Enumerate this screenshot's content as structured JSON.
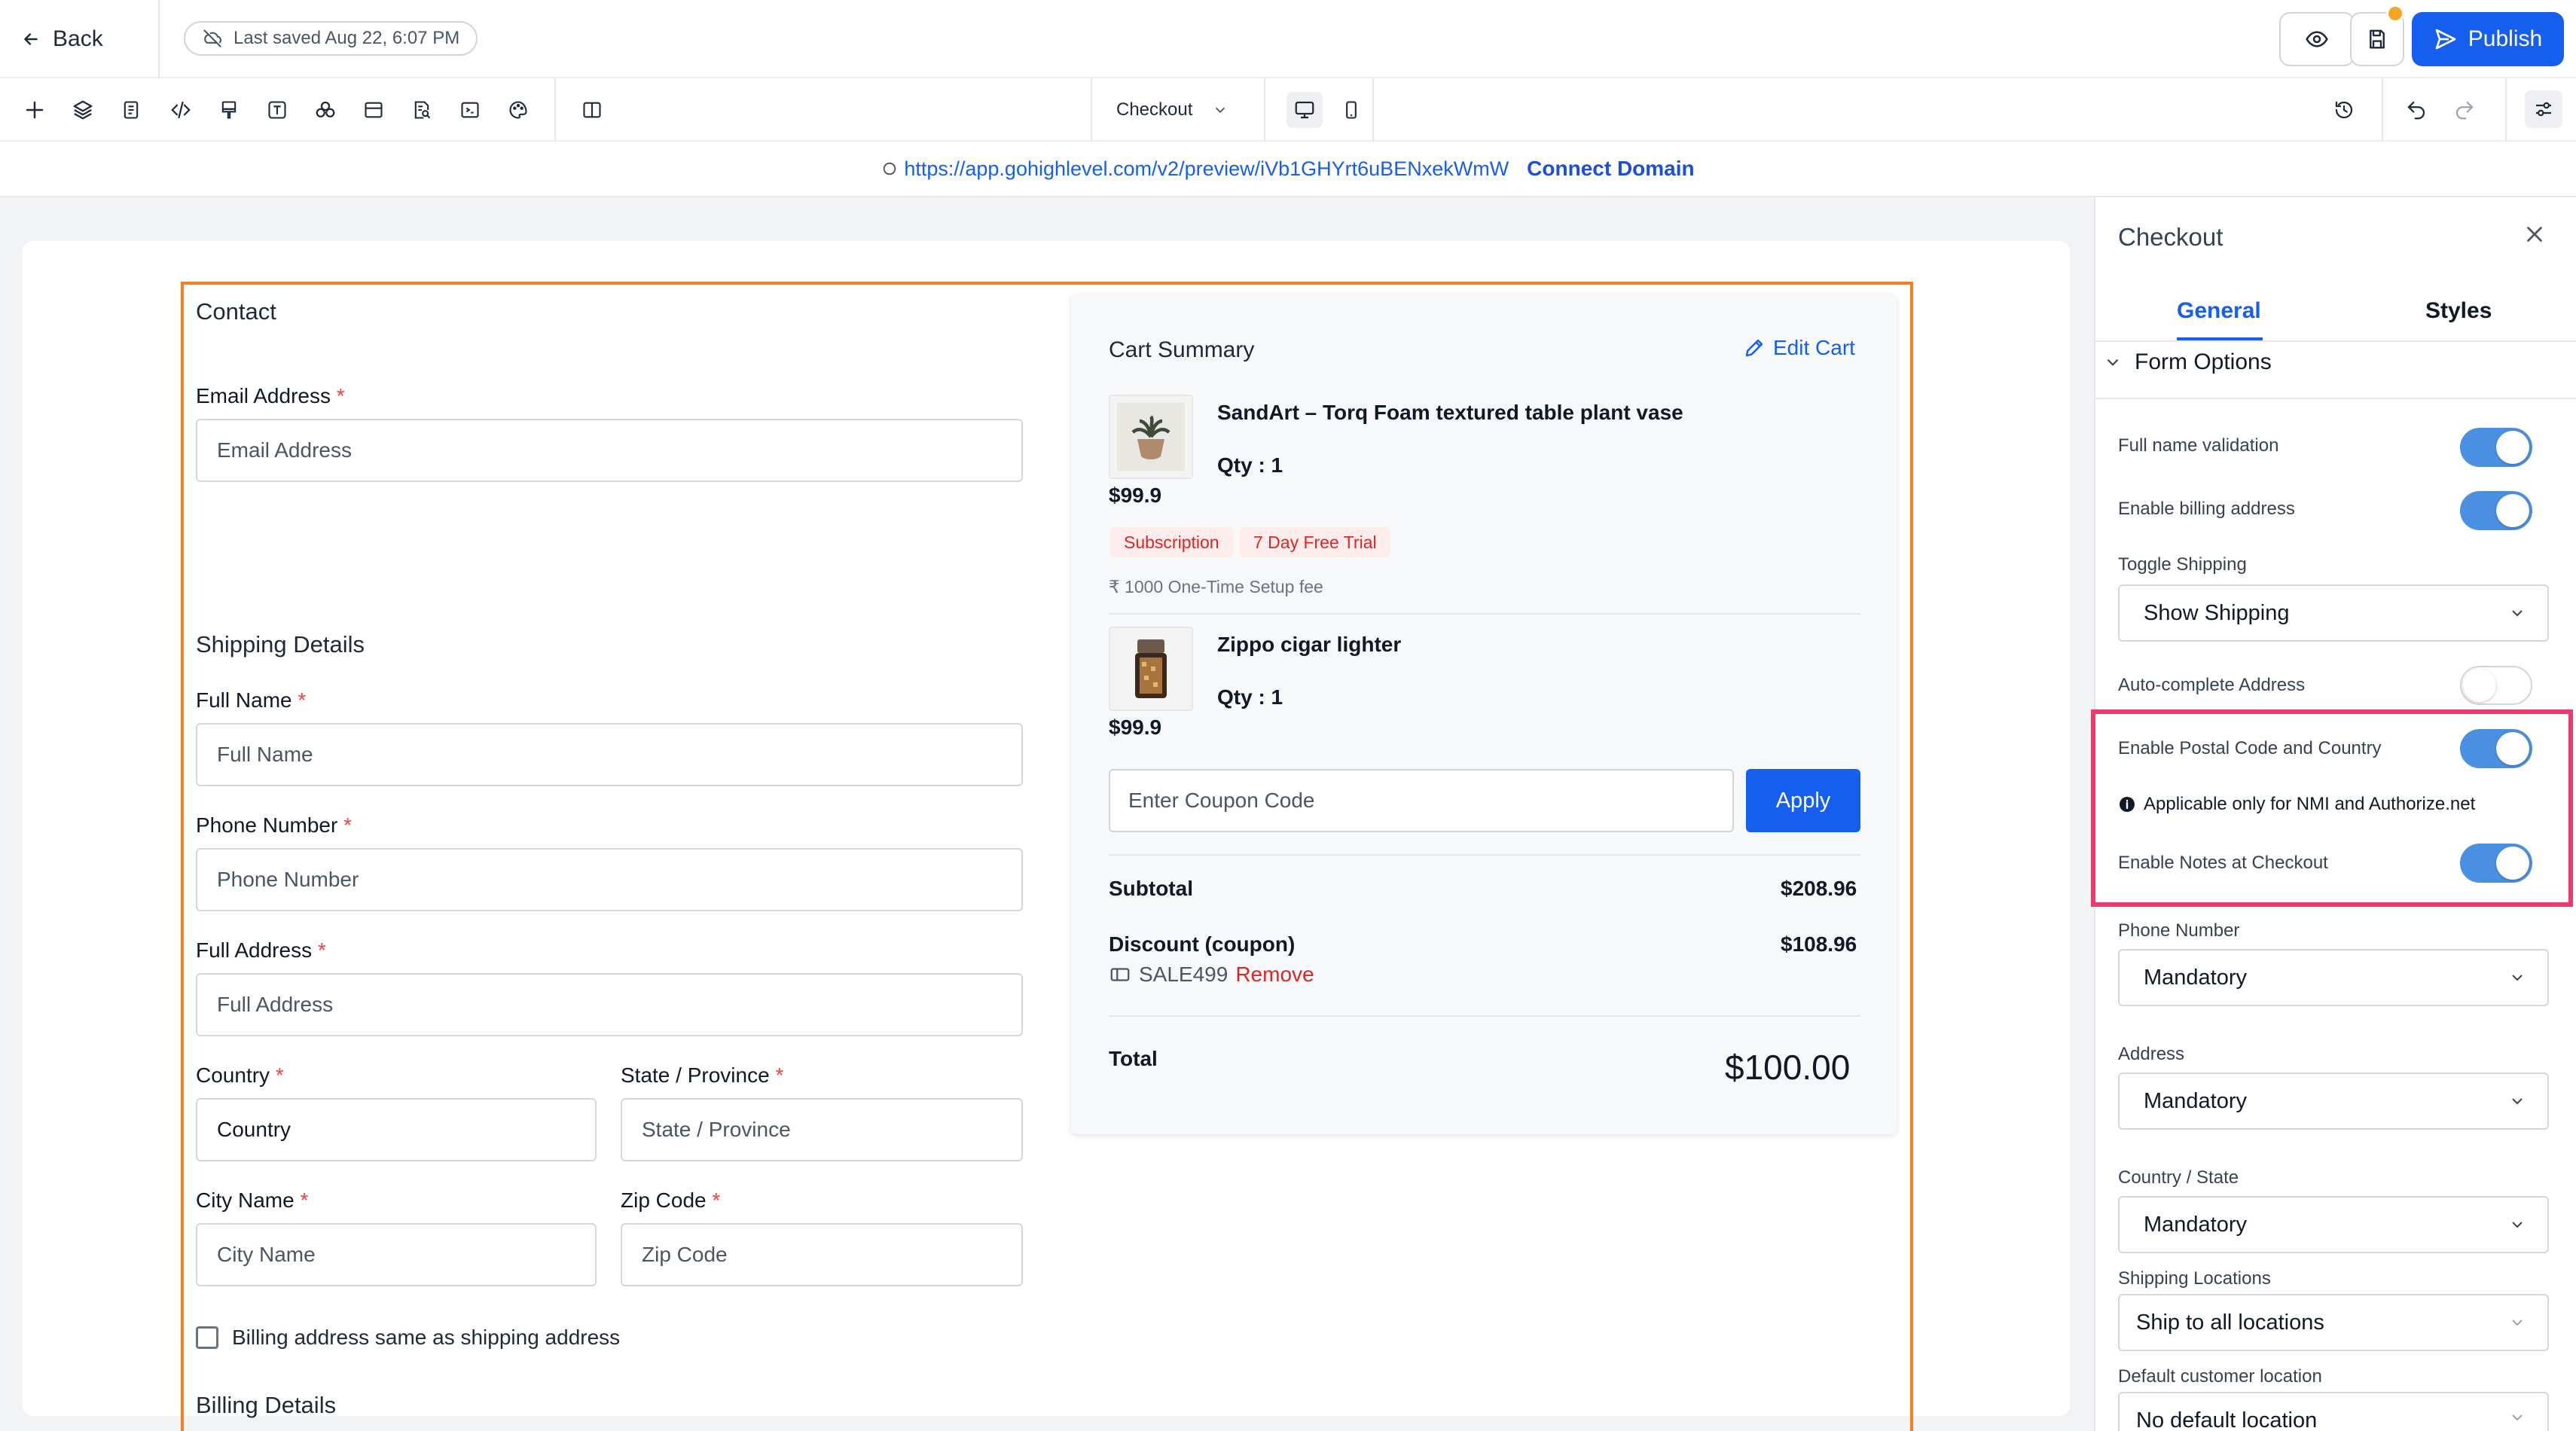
{
  "topbar": {
    "back_label": "Back",
    "saved_text": "Last saved Aug 22, 6:07 PM",
    "publish_label": "Publish"
  },
  "toolbar": {
    "tools": [
      "add-icon",
      "layers-icon",
      "pages-icon",
      "code-icon",
      "paint-icon",
      "text-icon",
      "assets-icon",
      "sections-icon",
      "search-doc-icon",
      "terminal-icon",
      "palette-icon",
      "columns-icon"
    ],
    "page_name": "Checkout"
  },
  "urlbar": {
    "url": "https://app.gohighlevel.com/v2/preview/iVb1GHYrt6uBENxekWmW",
    "connect_label": "Connect Domain"
  },
  "form": {
    "contact_title": "Contact",
    "email_label": "Email Address",
    "email_placeholder": "Email Address",
    "shipping_title": "Shipping Details",
    "fullname_label": "Full Name",
    "fullname_placeholder": "Full Name",
    "phone_label": "Phone Number",
    "phone_placeholder": "Phone Number",
    "address_label": "Full Address",
    "address_placeholder": "Full Address",
    "country_label": "Country",
    "country_value": "Country",
    "state_label": "State / Province",
    "state_placeholder": "State / Province",
    "city_label": "City Name",
    "city_placeholder": "City Name",
    "zip_label": "Zip Code",
    "zip_placeholder": "Zip Code",
    "billing_same_label": "Billing address same as shipping address",
    "billing_title": "Billing Details",
    "required_mark": "*"
  },
  "cart": {
    "title": "Cart Summary",
    "edit_label": "Edit Cart",
    "items": [
      {
        "name": "SandArt – Torq Foam textured table plant vase",
        "qty": "Qty : 1",
        "price": "$99.9",
        "badges": [
          "Subscription",
          "7 Day Free Trial"
        ],
        "setup_fee": "₹ 1000 One-Time Setup fee"
      },
      {
        "name": "Zippo cigar lighter",
        "qty": "Qty : 1",
        "price": "$99.9"
      }
    ],
    "coupon_placeholder": "Enter Coupon Code",
    "apply_label": "Apply",
    "subtotal_label": "Subtotal",
    "subtotal_value": "$208.96",
    "discount_label": "Discount (coupon)",
    "discount_value": "$108.96",
    "coupon_code": "SALE499",
    "remove_label": "Remove",
    "total_label": "Total",
    "total_value": "$100.00"
  },
  "panel": {
    "title": "Checkout",
    "tabs": [
      "General",
      "Styles"
    ],
    "section": "Form Options",
    "full_name_validation": "Full name validation",
    "enable_billing": "Enable billing address",
    "toggle_shipping": "Toggle Shipping",
    "toggle_shipping_value": "Show Shipping",
    "autocomplete": "Auto-complete Address",
    "postal_country": "Enable Postal Code and Country",
    "info_note": "Applicable only for NMI and Authorize.net",
    "notes_checkout": "Enable Notes at Checkout",
    "phone_label": "Phone Number",
    "phone_value": "Mandatory",
    "address_label": "Address",
    "address_value": "Mandatory",
    "country_state_label": "Country / State",
    "country_state_value": "Mandatory",
    "ship_locations_label": "Shipping Locations",
    "ship_locations_value": "Ship to all locations",
    "default_location_label": "Default customer location",
    "default_location_value": "No default location"
  },
  "colors": {
    "primary": "#155eef",
    "orange_outline": "#f58024",
    "highlight": "#ec3a6e",
    "toggle_on": "#4a90e2",
    "danger": "#dc2626"
  }
}
